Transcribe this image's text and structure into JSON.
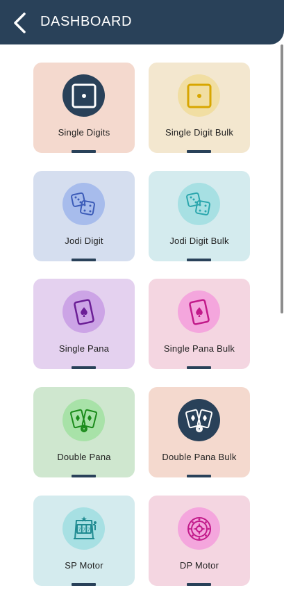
{
  "header": {
    "title": "DASHBOARD"
  },
  "cards": [
    {
      "label": "Single Digits",
      "bg": "#f4d9ce",
      "icon_bg": "#294159",
      "icon": "die-one-dark-icon"
    },
    {
      "label": "Single Digit Bulk",
      "bg": "#f3e7cf",
      "icon_bg": "#f1dea2",
      "icon": "die-one-gold-icon"
    },
    {
      "label": "Jodi Digit",
      "bg": "#d5deef",
      "icon_bg": "#a7bcec",
      "icon": "dice-pair-blue-icon"
    },
    {
      "label": "Jodi Digit Bulk",
      "bg": "#d4ebee",
      "icon_bg": "#a7e0e3",
      "icon": "dice-pair-teal-icon"
    },
    {
      "label": "Single Pana",
      "bg": "#e4d1ef",
      "icon_bg": "#cca4e6",
      "icon": "spade-card-purple-icon"
    },
    {
      "label": "Single Pana Bulk",
      "bg": "#f4d6e1",
      "icon_bg": "#f4a6dd",
      "icon": "spade-card-pink-icon"
    },
    {
      "label": "Double Pana",
      "bg": "#cfe7cf",
      "icon_bg": "#a8e2a8",
      "icon": "two-cards-green-icon"
    },
    {
      "label": "Double Pana Bulk",
      "bg": "#f4d9ce",
      "icon_bg": "#294159",
      "icon": "two-cards-dark-icon"
    },
    {
      "label": "SP Motor",
      "bg": "#d4ebee",
      "icon_bg": "#a7e0e3",
      "icon": "slot-machine-icon"
    },
    {
      "label": "DP Motor",
      "bg": "#f4d6e1",
      "icon_bg": "#f4a6dd",
      "icon": "roulette-wheel-icon"
    }
  ]
}
